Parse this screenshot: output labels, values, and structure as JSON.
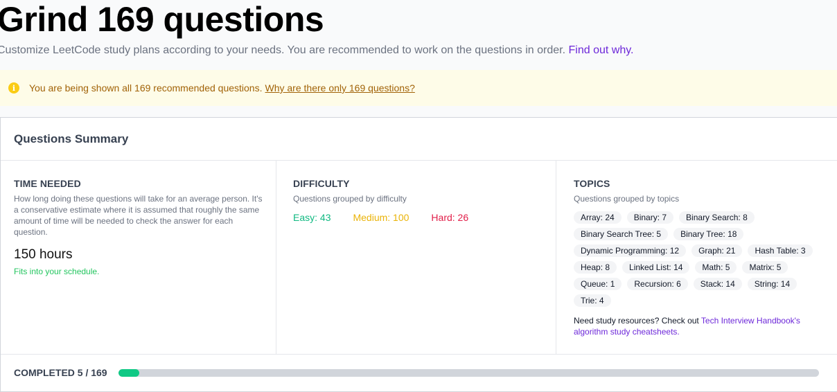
{
  "header": {
    "title": "Grind 169 questions",
    "subtitle": "Customize LeetCode study plans according to your needs. You are recommended to work on the questions in order.",
    "subtitle_link": "Find out why."
  },
  "notice": {
    "icon": "info-icon",
    "text": "You are being shown all 169 recommended questions.",
    "link": "Why are there only 169 questions?",
    "color": "#a16207",
    "background": "#fefce8"
  },
  "summary": {
    "title": "Questions Summary",
    "time": {
      "heading": "TIME NEEDED",
      "description": "How long doing these questions will take for an average person. It's a conservative estimate where it is assumed that roughly the same amount of time will be needed to check the answer for each question.",
      "hours": "150 hours",
      "status": "Fits into your schedule."
    },
    "difficulty": {
      "heading": "DIFFICULTY",
      "description": "Questions grouped by difficulty",
      "easy": "Easy: 43",
      "medium": "Medium: 100",
      "hard": "Hard: 26"
    },
    "topics": {
      "heading": "TOPICS",
      "description": "Questions grouped by topics",
      "chips": [
        "Array: 24",
        "Binary: 7",
        "Binary Search: 8",
        "Binary Search Tree: 5",
        "Binary Tree: 18",
        "Dynamic Programming: 12",
        "Graph: 21",
        "Hash Table: 3",
        "Heap: 8",
        "Linked List: 14",
        "Math: 5",
        "Matrix: 5",
        "Queue: 1",
        "Recursion: 6",
        "Stack: 14",
        "String: 14",
        "Trie: 4"
      ],
      "resources_text": "Need study resources? Check out",
      "resources_link": "Tech Interview Handbook's algorithm study cheatsheets."
    }
  },
  "progress": {
    "label": "COMPLETED 5 / 169",
    "completed": 5,
    "total": 169,
    "fill_color": "#10c985"
  }
}
